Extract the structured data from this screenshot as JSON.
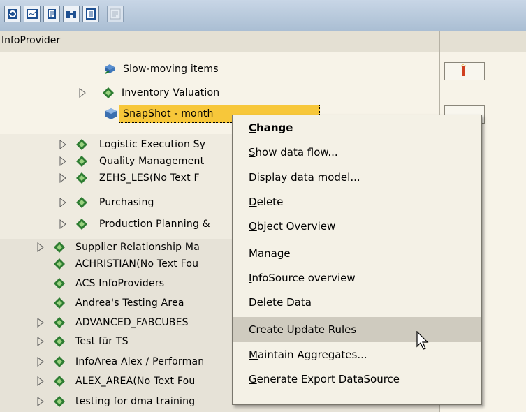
{
  "toolbar": {
    "icons": [
      "refresh-icon",
      "display-icon",
      "script-icon",
      "find-icon",
      "settings-icon",
      "info-icon"
    ]
  },
  "header": {
    "column_label": "InfoProvider"
  },
  "tree": {
    "rows": [
      {
        "label": "Slow-moving items",
        "expander": false,
        "icon": "infocube-sync-icon"
      },
      {
        "label": "Inventory Valuation",
        "expander": true,
        "icon": "infoarea-icon"
      },
      {
        "label": "SnapShot - month",
        "expander": false,
        "icon": "infocube-icon",
        "selected": true
      },
      {
        "label": "Logistic Execution Sy",
        "expander": true,
        "icon": "infoarea-icon"
      },
      {
        "label": "Quality Management",
        "expander": true,
        "icon": "infoarea-icon"
      },
      {
        "label": "ZEHS_LES(No Text F",
        "expander": true,
        "icon": "infoarea-icon"
      },
      {
        "label": "Purchasing",
        "expander": true,
        "icon": "infoarea-icon"
      },
      {
        "label": "Production Planning &",
        "expander": true,
        "icon": "infoarea-icon"
      },
      {
        "label": "Supplier Relationship Ma",
        "expander": true,
        "icon": "infoarea-icon"
      },
      {
        "label": "ACHRISTIAN(No Text Fou",
        "expander": false,
        "icon": "infoarea-icon"
      },
      {
        "label": "ACS InfoProviders",
        "expander": false,
        "icon": "infoarea-icon"
      },
      {
        "label": "Andrea's Testing Area",
        "expander": false,
        "icon": "infoarea-icon"
      },
      {
        "label": "ADVANCED_FABCUBES",
        "expander": true,
        "icon": "infoarea-icon"
      },
      {
        "label": "Test für TS",
        "expander": true,
        "icon": "infoarea-icon"
      },
      {
        "label": "InfoArea Alex / Performan",
        "expander": true,
        "icon": "infoarea-icon"
      },
      {
        "label": "ALEX_AREA(No Text Fou",
        "expander": true,
        "icon": "infoarea-icon"
      },
      {
        "label": "testing for dma training",
        "expander": true,
        "icon": "infoarea-icon"
      }
    ]
  },
  "context_menu": {
    "items": [
      {
        "label": "Change",
        "mnemonic": "C",
        "rest": "hange",
        "bold": true
      },
      {
        "label": "Show data flow...",
        "mnemonic": "S",
        "rest": "how data flow..."
      },
      {
        "label": "Display data model...",
        "mnemonic": "D",
        "rest": "isplay data model..."
      },
      {
        "label": "Delete",
        "mnemonic": "D",
        "rest": "elete"
      },
      {
        "label": "Object Overview",
        "mnemonic": "O",
        "rest": "bject Overview"
      },
      {
        "label": "Manage",
        "mnemonic": "M",
        "rest": "anage"
      },
      {
        "label": "InfoSource overview",
        "mnemonic": "I",
        "rest": "nfoSource overview"
      },
      {
        "label": "Delete Data",
        "mnemonic": "D",
        "rest": "elete Data"
      },
      {
        "label": "Create Update Rules",
        "mnemonic": "C",
        "rest": "reate Update Rules",
        "highlighted": true
      },
      {
        "label": "Maintain Aggregates...",
        "mnemonic": "M",
        "rest": "aintain Aggregates..."
      },
      {
        "label": "Generate Export DataSource",
        "mnemonic": "G",
        "rest": "enerate Export DataSource"
      }
    ]
  },
  "colors": {
    "selection": "#f7c73a",
    "menu_highlight": "#cfcbbf",
    "infoarea_icon": "#2e7d32"
  }
}
